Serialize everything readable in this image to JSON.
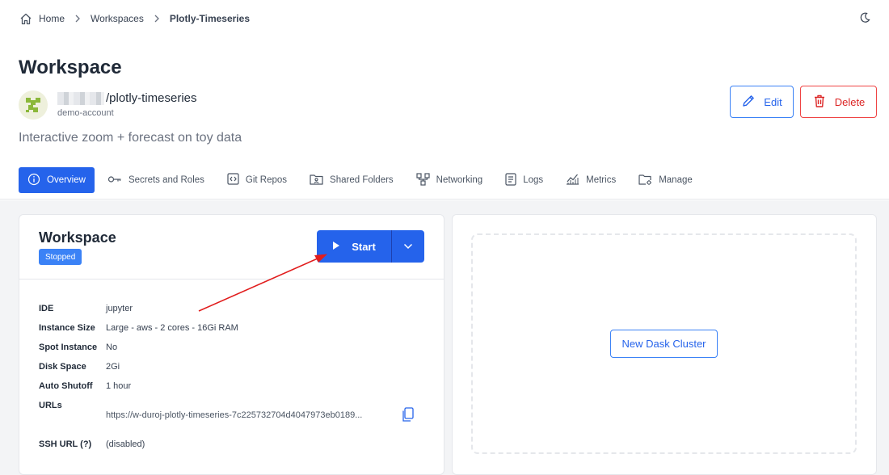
{
  "breadcrumb": {
    "home": "Home",
    "workspaces": "Workspaces",
    "current": "Plotly-Timeseries"
  },
  "header": {
    "title": "Workspace",
    "workspace_name": "/plotly-timeseries",
    "account": "demo-account",
    "description": "Interactive zoom + forecast on toy data",
    "edit_label": "Edit",
    "delete_label": "Delete"
  },
  "tabs": [
    {
      "label": "Overview",
      "icon": "info-icon",
      "active": true
    },
    {
      "label": "Secrets and Roles",
      "icon": "key-icon"
    },
    {
      "label": "Git Repos",
      "icon": "code-icon"
    },
    {
      "label": "Shared Folders",
      "icon": "folder-user-icon"
    },
    {
      "label": "Networking",
      "icon": "network-icon"
    },
    {
      "label": "Logs",
      "icon": "document-icon"
    },
    {
      "label": "Metrics",
      "icon": "chart-icon"
    },
    {
      "label": "Manage",
      "icon": "folder-gear-icon"
    }
  ],
  "workspace_card": {
    "title": "Workspace",
    "status": "Stopped",
    "start_label": "Start",
    "details": [
      {
        "key": "IDE",
        "value": "jupyter"
      },
      {
        "key": "Instance Size",
        "value": "Large - aws - 2 cores - 16Gi RAM"
      },
      {
        "key": "Spot Instance",
        "value": "No"
      },
      {
        "key": "Disk Space",
        "value": "2Gi"
      },
      {
        "key": "Auto Shutoff",
        "value": "1 hour"
      }
    ],
    "urls_label": "URLs",
    "url": "https://w-duroj-plotly-timeseries-7c225732704d4047973eb0189...",
    "ssh_label": "SSH URL",
    "ssh_hint": "(?)",
    "ssh_value": "(disabled)"
  },
  "dask": {
    "button_label": "New Dask Cluster"
  },
  "colors": {
    "primary": "#2563eb",
    "danger": "#dc2626",
    "annotation_arrow": "#e11d1d"
  }
}
